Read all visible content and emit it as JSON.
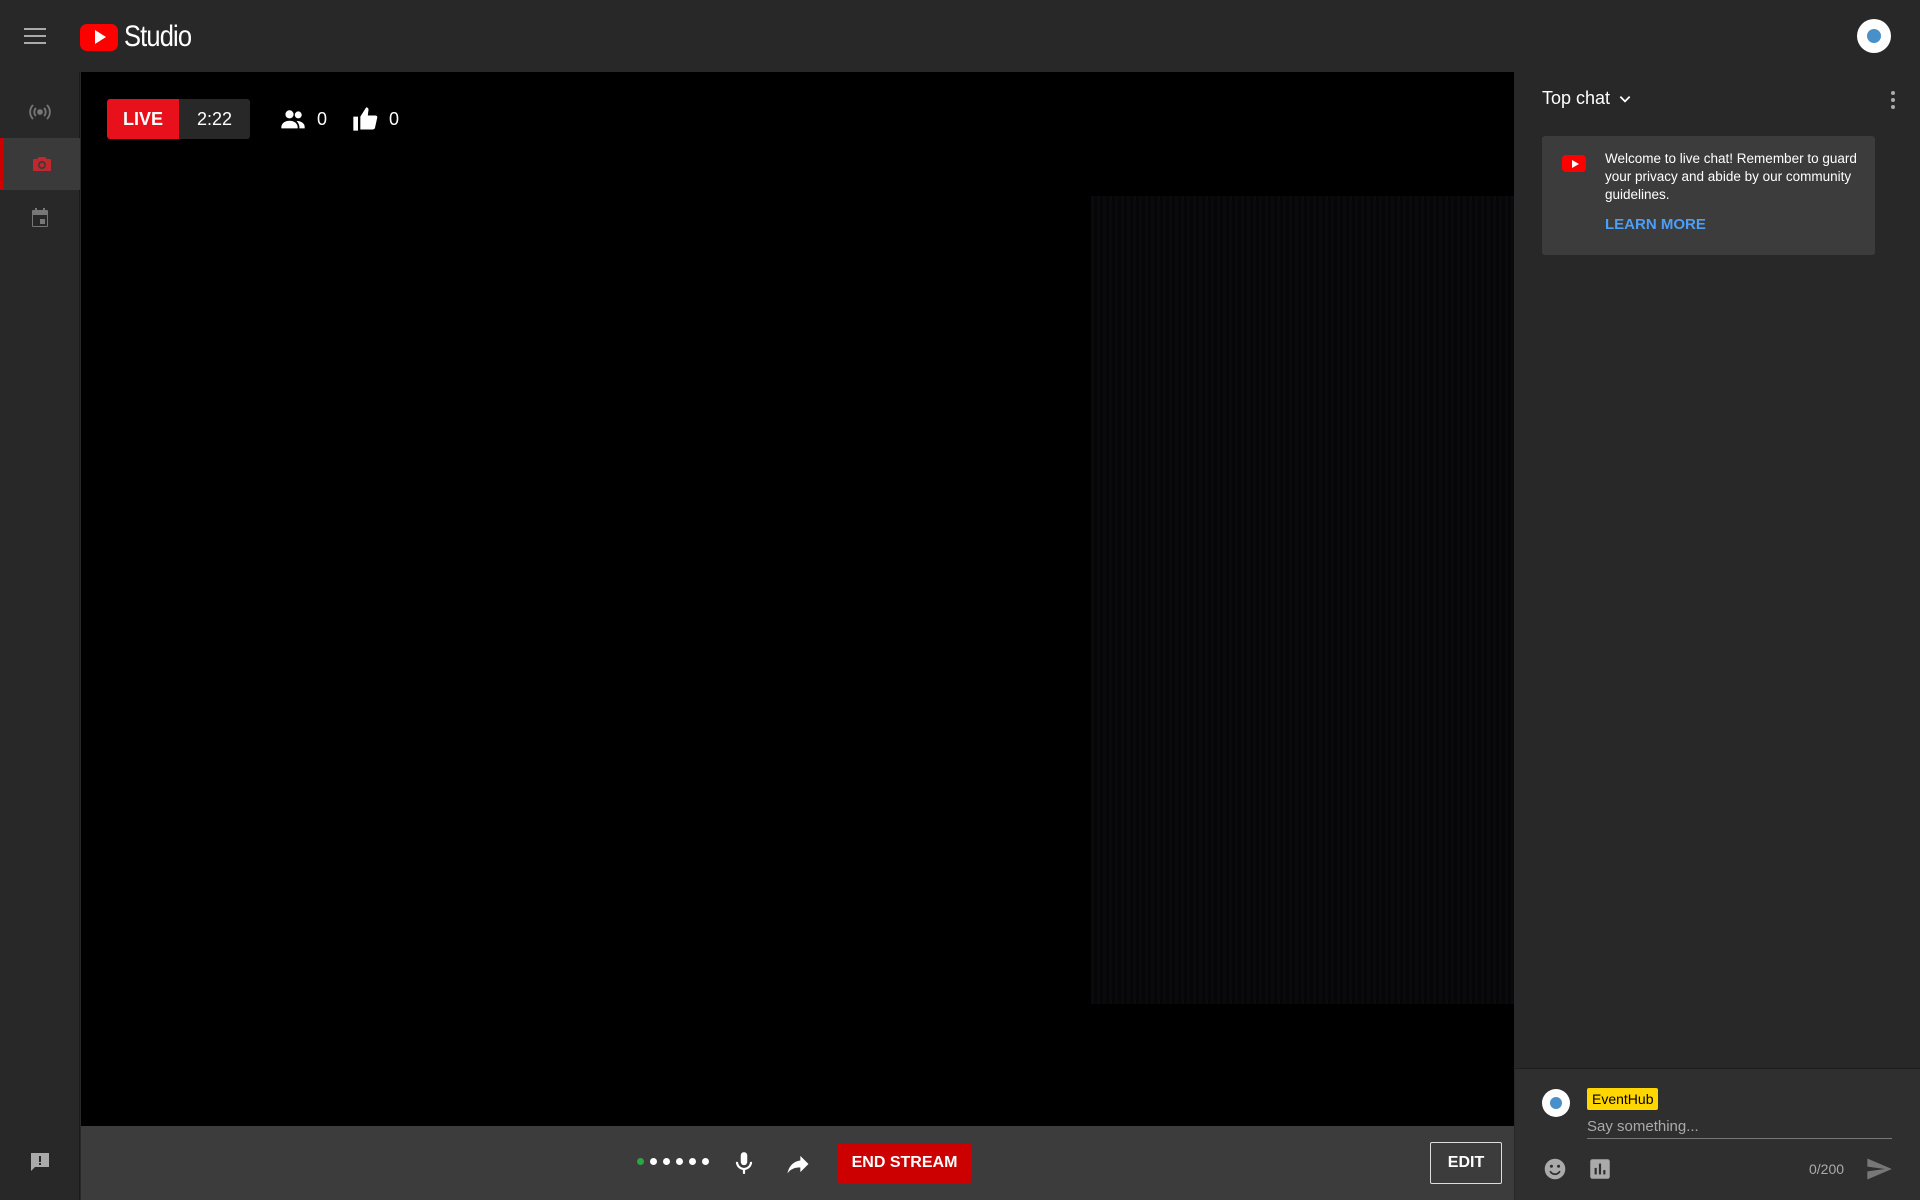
{
  "app": {
    "logo_text": "Studio"
  },
  "stream": {
    "live_label": "LIVE",
    "elapsed": "2:22",
    "viewers": "0",
    "likes": "0"
  },
  "controls": {
    "end_stream_label": "END STREAM",
    "edit_label": "EDIT"
  },
  "chat": {
    "mode_label": "Top chat",
    "welcome_message": "Welcome to live chat! Remember to guard your privacy and abide by our community guidelines.",
    "learn_more_label": "LEARN MORE",
    "author_name": "EventHub",
    "input_placeholder": "Say something...",
    "char_counter": "0/200"
  },
  "nav": {
    "items": [
      {
        "icon": "live-broadcast-icon",
        "active": false
      },
      {
        "icon": "camera-icon",
        "active": true
      },
      {
        "icon": "calendar-icon",
        "active": false
      }
    ]
  },
  "colors": {
    "accent_red": "#e8101a",
    "end_stream_red": "#cc0000",
    "link_blue": "#4c9ff5",
    "author_badge": "#ffd600",
    "connection_good": "#2ba640"
  }
}
